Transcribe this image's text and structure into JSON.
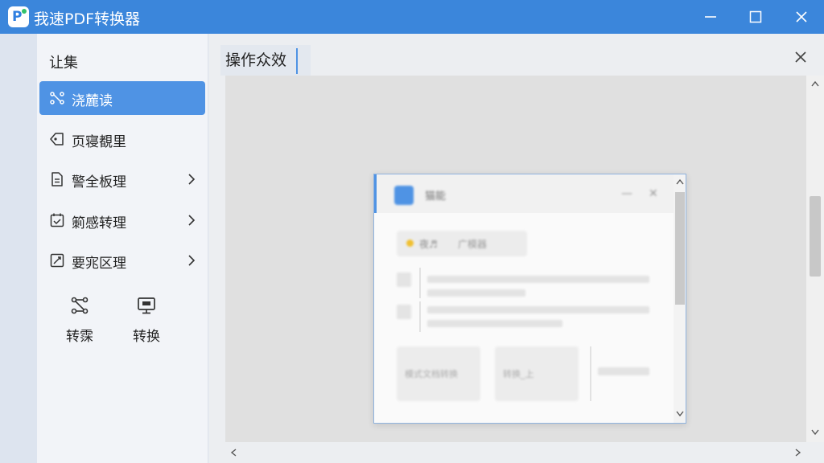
{
  "app": {
    "title": "我速PDF转换器",
    "logo_letter": "P"
  },
  "colors": {
    "titlebar": "#3b86db",
    "accent": "#4f93e4",
    "sidebar_bg": "#f2f4f8",
    "preview_bg": "#e0e0e0"
  },
  "sidebar": {
    "heading": "让集",
    "items": [
      {
        "label": "浇麓读",
        "icon": "scatter-nodes-icon",
        "active": true,
        "has_submenu": false
      },
      {
        "label": "页寝覩里",
        "icon": "tag-icon",
        "active": false,
        "has_submenu": false
      },
      {
        "label": "警全板理",
        "icon": "document-icon",
        "active": false,
        "has_submenu": true
      },
      {
        "label": "箣感转理",
        "icon": "calendar-check-icon",
        "active": false,
        "has_submenu": true
      },
      {
        "label": "要宨区理",
        "icon": "edit-square-icon",
        "active": false,
        "has_submenu": true
      }
    ],
    "tools": [
      {
        "label": "转霂",
        "icon": "flow-nodes-icon"
      },
      {
        "label": "转换",
        "icon": "monitor-icon"
      }
    ]
  },
  "main": {
    "tab_label": "操作众效",
    "preview_window": {
      "title": "猫能",
      "chip_text_1": "夜♬",
      "chip_text_2": "广模器",
      "card_1_text": "模式文档转换",
      "card_2_text": "转换_上"
    }
  }
}
